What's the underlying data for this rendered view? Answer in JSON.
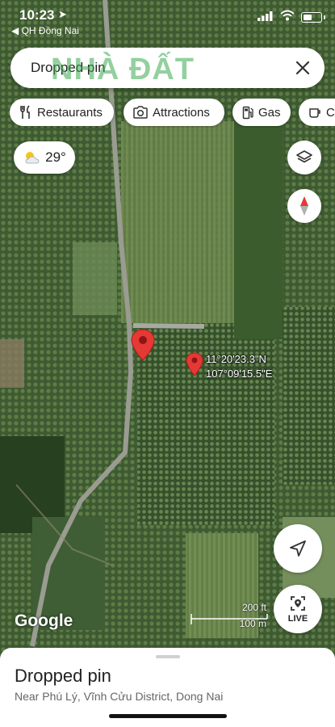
{
  "status_bar": {
    "time": "10:23",
    "back_app": "◀ QH Đồng Nai"
  },
  "search": {
    "query": "Dropped pin",
    "watermark": "NHÀ ĐẤT"
  },
  "chips": [
    {
      "label": "Restaurants",
      "icon": "fork-knife-icon"
    },
    {
      "label": "Attractions",
      "icon": "camera-icon"
    },
    {
      "label": "Gas",
      "icon": "gas-pump-icon"
    },
    {
      "label": "C",
      "icon": "coffee-icon"
    }
  ],
  "weather": {
    "temperature": "29°",
    "icon": "partly-cloudy-icon"
  },
  "pin": {
    "lat": "11°20'23.3\"N",
    "lng": "107°09'15.5\"E"
  },
  "map": {
    "attribution": "Google",
    "scale_ft": "200 ft",
    "scale_m": "100 m"
  },
  "live_button": {
    "label": "LIVE"
  },
  "sheet": {
    "title": "Dropped pin",
    "subtitle": "Near Phú Lý, Vĩnh Cửu District, Dong Nai"
  },
  "colors": {
    "pin_red": "#e53935",
    "map_dark": "#2f4a2a",
    "field_green": "#6f8a4e"
  }
}
